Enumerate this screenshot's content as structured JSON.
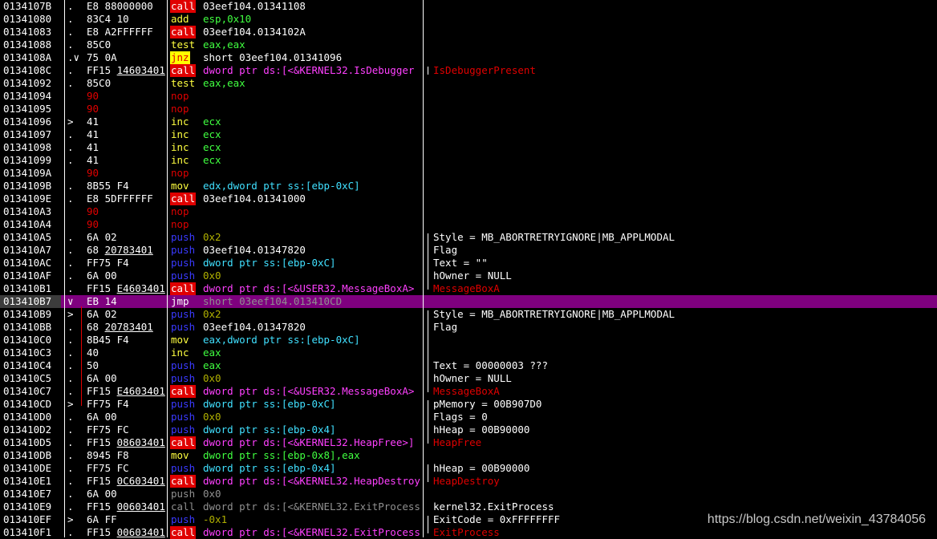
{
  "rows": [
    {
      "addr": "0134107B",
      "mark": ".",
      "bytes": "E8 88000000",
      "mnem": "call",
      "mc": "m-call",
      "ops": "03eef104.01341108",
      "oc": "o-white",
      "cmt": ""
    },
    {
      "addr": "01341080",
      "mark": ".",
      "bytes": "83C4 10",
      "mnem": "add",
      "mc": "m-add",
      "ops": "esp,0x10",
      "oc": "o-green",
      "cmt": ""
    },
    {
      "addr": "01341083",
      "mark": ".",
      "bytes": "E8 A2FFFFFF",
      "mnem": "call",
      "mc": "m-call",
      "ops": "03eef104.0134102A",
      "oc": "o-white",
      "cmt": ""
    },
    {
      "addr": "01341088",
      "mark": ".",
      "bytes": "85C0",
      "mnem": "test",
      "mc": "m-test",
      "ops": "eax,eax",
      "oc": "o-green",
      "cmt": ""
    },
    {
      "addr": "0134108A",
      "mark": ".∨",
      "bytes": "75 0A",
      "mnem": "jnz",
      "mc": "m-jnz",
      "ops": "short 03eef104.01341096",
      "oc": "o-white",
      "cmt": ""
    },
    {
      "addr": "0134108C",
      "mark": ".",
      "bytes": "FF15 14603401",
      "mnem": "call",
      "mc": "m-call",
      "ops": "dword ptr ds:[<&KERNEL32.IsDebugger",
      "oc": "o-magenta",
      "cmt": "IsDebuggerPresent",
      "cc": "c-red"
    },
    {
      "addr": "01341092",
      "mark": ".",
      "bytes": "85C0",
      "mnem": "test",
      "mc": "m-test",
      "ops": "eax,eax",
      "oc": "o-green",
      "cmt": ""
    },
    {
      "addr": "01341094",
      "mark": "",
      "bytes": "90",
      "bc": "b-red",
      "mnem": "nop",
      "mc": "m-nop",
      "ops": "",
      "oc": "o-white",
      "cmt": ""
    },
    {
      "addr": "01341095",
      "mark": "",
      "bytes": "90",
      "bc": "b-red",
      "mnem": "nop",
      "mc": "m-nop",
      "ops": "",
      "oc": "o-white",
      "cmt": ""
    },
    {
      "addr": "01341096",
      "mark": ">",
      "bytes": "41",
      "mnem": "inc",
      "mc": "m-inc",
      "ops": "ecx",
      "oc": "o-green",
      "cmt": ""
    },
    {
      "addr": "01341097",
      "mark": ".",
      "bytes": "41",
      "mnem": "inc",
      "mc": "m-inc",
      "ops": "ecx",
      "oc": "o-green",
      "cmt": ""
    },
    {
      "addr": "01341098",
      "mark": ".",
      "bytes": "41",
      "mnem": "inc",
      "mc": "m-inc",
      "ops": "ecx",
      "oc": "o-green",
      "cmt": ""
    },
    {
      "addr": "01341099",
      "mark": ".",
      "bytes": "41",
      "mnem": "inc",
      "mc": "m-inc",
      "ops": "ecx",
      "oc": "o-green",
      "cmt": ""
    },
    {
      "addr": "0134109A",
      "mark": "",
      "bytes": "90",
      "bc": "b-red",
      "mnem": "nop",
      "mc": "m-nop",
      "ops": "",
      "oc": "o-white",
      "cmt": ""
    },
    {
      "addr": "0134109B",
      "mark": ".",
      "bytes": "8B55 F4",
      "mnem": "mov",
      "mc": "m-mov",
      "ops": "edx,dword ptr ss:[ebp-0xC]",
      "oc": "o-cyan",
      "cmt": ""
    },
    {
      "addr": "0134109E",
      "mark": ".",
      "bytes": "E8 5DFFFFFF",
      "mnem": "call",
      "mc": "m-call",
      "ops": "03eef104.01341000",
      "oc": "o-white",
      "cmt": ""
    },
    {
      "addr": "013410A3",
      "mark": "",
      "bytes": "90",
      "bc": "b-red",
      "mnem": "nop",
      "mc": "m-nop",
      "ops": "",
      "oc": "o-white",
      "cmt": ""
    },
    {
      "addr": "013410A4",
      "mark": "",
      "bytes": "90",
      "bc": "b-red",
      "mnem": "nop",
      "mc": "m-nop",
      "ops": "",
      "oc": "o-white",
      "cmt": ""
    },
    {
      "addr": "013410A5",
      "mark": ".",
      "bytes": "6A 02",
      "mnem": "push",
      "mc": "m-push",
      "ops": "0x2",
      "oc": "o-olive",
      "cmt": "Style = MB_ABORTRETRYIGNORE|MB_APPLMODAL",
      "cc": "c-white"
    },
    {
      "addr": "013410A7",
      "mark": ".",
      "bytes": "68 20783401",
      "mnem": "push",
      "mc": "m-push",
      "ops": "03eef104.01347820",
      "oc": "o-white",
      "cmt": "Flag",
      "cc": "c-white"
    },
    {
      "addr": "013410AC",
      "mark": ".",
      "bytes": "FF75 F4",
      "mnem": "push",
      "mc": "m-push",
      "ops": "dword ptr ss:[ebp-0xC]",
      "oc": "o-cyan",
      "cmt": "Text = \"\"",
      "cc": "c-white"
    },
    {
      "addr": "013410AF",
      "mark": ".",
      "bytes": "6A 00",
      "mnem": "push",
      "mc": "m-push",
      "ops": "0x0",
      "oc": "o-olive",
      "cmt": "hOwner = NULL",
      "cc": "c-white"
    },
    {
      "addr": "013410B1",
      "mark": ".",
      "bytes": "FF15 E4603401",
      "mnem": "call",
      "mc": "m-call",
      "ops": "dword ptr ds:[<&USER32.MessageBoxA>",
      "oc": "o-magenta",
      "cmt": "MessageBoxA",
      "cc": "c-red"
    },
    {
      "addr": "013410B7",
      "mark": "∨",
      "bytes": "EB 14",
      "mnem": "jmp",
      "mc": "m-jmp",
      "ops": "short 03eef104.013410CD",
      "oc": "o-gray",
      "cmt": "",
      "sel": true
    },
    {
      "addr": "013410B9",
      "mark": ">",
      "bytes": "6A 02",
      "mnem": "push",
      "mc": "m-push",
      "ops": "0x2",
      "oc": "o-olive",
      "cmt": "Style = MB_ABORTRETRYIGNORE|MB_APPLMODAL",
      "cc": "c-white"
    },
    {
      "addr": "013410BB",
      "mark": ".",
      "bytes": "68 20783401",
      "mnem": "push",
      "mc": "m-push",
      "ops": "03eef104.01347820",
      "oc": "o-white",
      "cmt": "Flag",
      "cc": "c-white"
    },
    {
      "addr": "013410C0",
      "mark": ".",
      "bytes": "8B45 F4",
      "mnem": "mov",
      "mc": "m-mov",
      "ops": "eax,dword ptr ss:[ebp-0xC]",
      "oc": "o-cyan",
      "cmt": ""
    },
    {
      "addr": "013410C3",
      "mark": ".",
      "bytes": "40",
      "mnem": "inc",
      "mc": "m-inc",
      "ops": "eax",
      "oc": "o-green",
      "cmt": ""
    },
    {
      "addr": "013410C4",
      "mark": ".",
      "bytes": "50",
      "mnem": "push",
      "mc": "m-push",
      "ops": "eax",
      "oc": "o-green",
      "cmt": "Text = 00000003 ???",
      "cc": "c-white"
    },
    {
      "addr": "013410C5",
      "mark": ".",
      "bytes": "6A 00",
      "mnem": "push",
      "mc": "m-push",
      "ops": "0x0",
      "oc": "o-olive",
      "cmt": "hOwner = NULL",
      "cc": "c-white"
    },
    {
      "addr": "013410C7",
      "mark": ".",
      "bytes": "FF15 E4603401",
      "mnem": "call",
      "mc": "m-call",
      "ops": "dword ptr ds:[<&USER32.MessageBoxA>",
      "oc": "o-magenta",
      "cmt": "MessageBoxA",
      "cc": "c-red"
    },
    {
      "addr": "013410CD",
      "mark": ">",
      "bytes": "FF75 F4",
      "mnem": "push",
      "mc": "m-push",
      "ops": "dword ptr ss:[ebp-0xC]",
      "oc": "o-cyan",
      "cmt": "pMemory = 00B907D0",
      "cc": "c-white"
    },
    {
      "addr": "013410D0",
      "mark": ".",
      "bytes": "6A 00",
      "mnem": "push",
      "mc": "m-push",
      "ops": "0x0",
      "oc": "o-olive",
      "cmt": "Flags = 0",
      "cc": "c-white"
    },
    {
      "addr": "013410D2",
      "mark": ".",
      "bytes": "FF75 FC",
      "mnem": "push",
      "mc": "m-push",
      "ops": "dword ptr ss:[ebp-0x4]",
      "oc": "o-cyan",
      "cmt": "hHeap = 00B90000",
      "cc": "c-white"
    },
    {
      "addr": "013410D5",
      "mark": ".",
      "bytes": "FF15 08603401",
      "mnem": "call",
      "mc": "m-call",
      "ops": "dword ptr ds:[<&KERNEL32.HeapFree>]",
      "oc": "o-magenta",
      "cmt": "HeapFree",
      "cc": "c-red"
    },
    {
      "addr": "013410DB",
      "mark": ".",
      "bytes": "8945 F8",
      "mnem": "mov",
      "mc": "m-mov",
      "ops": "dword ptr ss:[ebp-0x8],eax",
      "oc": "o-green",
      "cmt": ""
    },
    {
      "addr": "013410DE",
      "mark": ".",
      "bytes": "FF75 FC",
      "mnem": "push",
      "mc": "m-push",
      "ops": "dword ptr ss:[ebp-0x4]",
      "oc": "o-cyan",
      "cmt": "hHeap = 00B90000",
      "cc": "c-white"
    },
    {
      "addr": "013410E1",
      "mark": ".",
      "bytes": "FF15 0C603401",
      "mnem": "call",
      "mc": "m-call",
      "ops": "dword ptr ds:[<&KERNEL32.HeapDestroy",
      "oc": "o-magenta",
      "cmt": "HeapDestroy",
      "cc": "c-red"
    },
    {
      "addr": "013410E7",
      "mark": ".",
      "bytes": "6A 00",
      "mnem": "push",
      "mc": "m-gray",
      "ops": "0x0",
      "oc": "o-gray",
      "cmt": ""
    },
    {
      "addr": "013410E9",
      "mark": ".",
      "bytes": "FF15 00603401",
      "mnem": "call",
      "mc": "m-gray",
      "ops": "dword ptr ds:[<&KERNEL32.ExitProcess",
      "oc": "o-gray",
      "cmt": "kernel32.ExitProcess",
      "cc": "c-white"
    },
    {
      "addr": "013410EF",
      "mark": ">",
      "bytes": "6A FF",
      "mnem": "push",
      "mc": "m-push",
      "ops": "-0x1",
      "oc": "o-olive",
      "cmt": "ExitCode = 0xFFFFFFFF",
      "cc": "c-white"
    },
    {
      "addr": "013410F1",
      "mark": ".",
      "bytes": "FF15 00603401",
      "mnem": "call",
      "mc": "m-call",
      "ops": "dword ptr ds:[<&KERNEL32.ExitProcess",
      "oc": "o-magenta",
      "cmt": "ExitProcess",
      "cc": "c-red"
    }
  ],
  "watermark": "https://blog.csdn.net/weixin_43784056"
}
